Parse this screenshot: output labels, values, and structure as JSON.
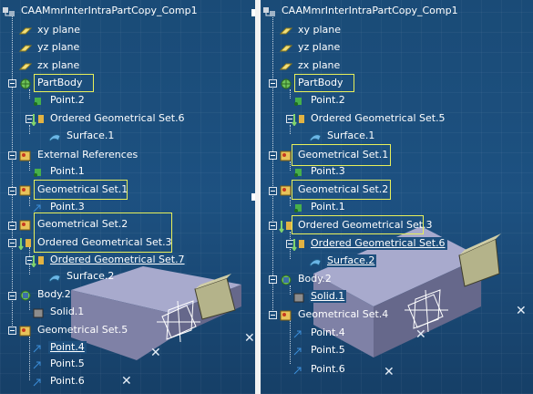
{
  "left": {
    "title": "CAAMmrInterIntraPartCopy_Comp1",
    "items": [
      {
        "label": "xy plane",
        "icon": "plane-icon"
      },
      {
        "label": "yz plane",
        "icon": "plane-icon"
      },
      {
        "label": "zx plane",
        "icon": "plane-icon"
      },
      {
        "label": "PartBody",
        "icon": "partbody-icon"
      },
      {
        "label": "Point.2",
        "icon": "point-icon"
      },
      {
        "label": "Ordered Geometrical Set.6",
        "icon": "ordered-geoset-icon"
      },
      {
        "label": "Surface.1",
        "icon": "surface-icon"
      },
      {
        "label": "External References",
        "icon": "geoset-icon"
      },
      {
        "label": "Point.1",
        "icon": "point-icon"
      },
      {
        "label": "Geometrical Set.1",
        "icon": "geoset-icon"
      },
      {
        "label": "Point.3",
        "icon": "point-icon"
      },
      {
        "label": "Geometrical Set.2",
        "icon": "geoset-icon"
      },
      {
        "label": "Ordered Geometrical Set.3",
        "icon": "ordered-geoset-icon"
      },
      {
        "label": "Ordered Geometrical Set.7",
        "icon": "ordered-geoset-icon"
      },
      {
        "label": "Surface.2",
        "icon": "surface-icon"
      },
      {
        "label": "Body.2",
        "icon": "body-icon"
      },
      {
        "label": "Solid.1",
        "icon": "solid-icon"
      },
      {
        "label": "Geometrical Set.5",
        "icon": "geoset-icon"
      },
      {
        "label": "Point.4",
        "icon": "point-icon"
      },
      {
        "label": "Point.5",
        "icon": "point-icon"
      },
      {
        "label": "Point.6",
        "icon": "point-icon"
      }
    ]
  },
  "right": {
    "title": "CAAMmrInterIntraPartCopy_Comp1",
    "items": [
      {
        "label": "xy plane",
        "icon": "plane-icon"
      },
      {
        "label": "yz plane",
        "icon": "plane-icon"
      },
      {
        "label": "zx plane",
        "icon": "plane-icon"
      },
      {
        "label": "PartBody",
        "icon": "partbody-icon"
      },
      {
        "label": "Point.2",
        "icon": "point-icon"
      },
      {
        "label": "Ordered Geometrical Set.5",
        "icon": "ordered-geoset-icon"
      },
      {
        "label": "Surface.1",
        "icon": "surface-icon"
      },
      {
        "label": "Geometrical Set.1",
        "icon": "geoset-icon"
      },
      {
        "label": "Point.3",
        "icon": "point-icon"
      },
      {
        "label": "Geometrical Set.2",
        "icon": "geoset-icon"
      },
      {
        "label": "Point.1",
        "icon": "point-icon"
      },
      {
        "label": "Ordered Geometrical Set.3",
        "icon": "ordered-geoset-icon"
      },
      {
        "label": "Ordered Geometrical Set.6",
        "icon": "ordered-geoset-icon"
      },
      {
        "label": "Surface.2",
        "icon": "surface-icon"
      },
      {
        "label": "Body.2",
        "icon": "body-icon"
      },
      {
        "label": "Solid.1",
        "icon": "solid-icon"
      },
      {
        "label": "Geometrical Set.4",
        "icon": "geoset-icon"
      },
      {
        "label": "Point.4",
        "icon": "point-icon"
      },
      {
        "label": "Point.5",
        "icon": "point-icon"
      },
      {
        "label": "Point.6",
        "icon": "point-icon"
      }
    ]
  },
  "colors": {
    "background": "#1d4f7d",
    "highlight_box": "#e8f05a",
    "text": "#ffffff",
    "solid_top": "#9a9cc2",
    "solid_side": "#b7b58a"
  }
}
